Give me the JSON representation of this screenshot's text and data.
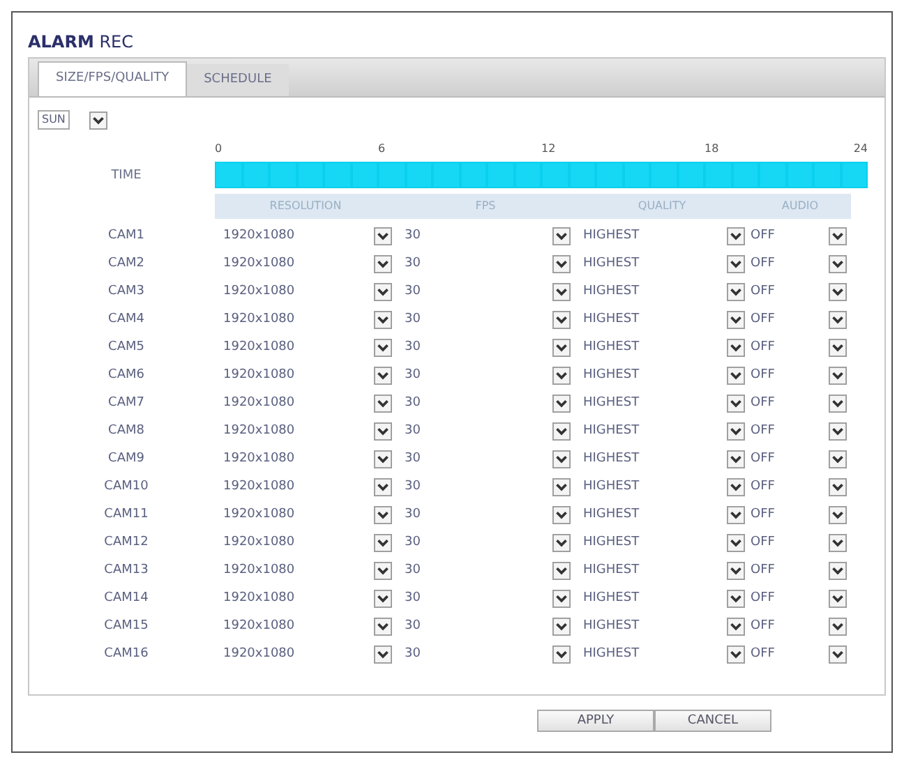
{
  "window": {
    "title_bold": "ALARM",
    "title_rest": "REC"
  },
  "tabs": [
    {
      "label": "SIZE/FPS/QUALITY",
      "selected": true
    },
    {
      "label": "SCHEDULE",
      "selected": false
    }
  ],
  "day_select": {
    "value": "SUN"
  },
  "time_axis": {
    "label": "TIME",
    "ticks": [
      "0",
      "6",
      "12",
      "18",
      "24"
    ]
  },
  "hours": [
    {
      "on": true
    },
    {
      "on": true
    },
    {
      "on": true
    },
    {
      "on": true
    },
    {
      "on": true
    },
    {
      "on": true
    },
    {
      "on": true
    },
    {
      "on": true
    },
    {
      "on": true
    },
    {
      "on": true
    },
    {
      "on": true
    },
    {
      "on": true
    },
    {
      "on": true
    },
    {
      "on": true
    },
    {
      "on": true
    },
    {
      "on": true
    },
    {
      "on": true
    },
    {
      "on": true
    },
    {
      "on": true
    },
    {
      "on": true
    },
    {
      "on": true
    },
    {
      "on": true
    },
    {
      "on": true
    },
    {
      "on": true
    }
  ],
  "table": {
    "columns": [
      "RESOLUTION",
      "FPS",
      "QUALITY",
      "AUDIO"
    ],
    "rows": [
      {
        "camera": "CAM1",
        "resolution": "1920x1080",
        "fps": "30",
        "quality": "HIGHEST",
        "audio": "OFF"
      },
      {
        "camera": "CAM2",
        "resolution": "1920x1080",
        "fps": "30",
        "quality": "HIGHEST",
        "audio": "OFF"
      },
      {
        "camera": "CAM3",
        "resolution": "1920x1080",
        "fps": "30",
        "quality": "HIGHEST",
        "audio": "OFF"
      },
      {
        "camera": "CAM4",
        "resolution": "1920x1080",
        "fps": "30",
        "quality": "HIGHEST",
        "audio": "OFF"
      },
      {
        "camera": "CAM5",
        "resolution": "1920x1080",
        "fps": "30",
        "quality": "HIGHEST",
        "audio": "OFF"
      },
      {
        "camera": "CAM6",
        "resolution": "1920x1080",
        "fps": "30",
        "quality": "HIGHEST",
        "audio": "OFF"
      },
      {
        "camera": "CAM7",
        "resolution": "1920x1080",
        "fps": "30",
        "quality": "HIGHEST",
        "audio": "OFF"
      },
      {
        "camera": "CAM8",
        "resolution": "1920x1080",
        "fps": "30",
        "quality": "HIGHEST",
        "audio": "OFF"
      },
      {
        "camera": "CAM9",
        "resolution": "1920x1080",
        "fps": "30",
        "quality": "HIGHEST",
        "audio": "OFF"
      },
      {
        "camera": "CAM10",
        "resolution": "1920x1080",
        "fps": "30",
        "quality": "HIGHEST",
        "audio": "OFF"
      },
      {
        "camera": "CAM11",
        "resolution": "1920x1080",
        "fps": "30",
        "quality": "HIGHEST",
        "audio": "OFF"
      },
      {
        "camera": "CAM12",
        "resolution": "1920x1080",
        "fps": "30",
        "quality": "HIGHEST",
        "audio": "OFF"
      },
      {
        "camera": "CAM13",
        "resolution": "1920x1080",
        "fps": "30",
        "quality": "HIGHEST",
        "audio": "OFF"
      },
      {
        "camera": "CAM14",
        "resolution": "1920x1080",
        "fps": "30",
        "quality": "HIGHEST",
        "audio": "OFF"
      },
      {
        "camera": "CAM15",
        "resolution": "1920x1080",
        "fps": "30",
        "quality": "HIGHEST",
        "audio": "OFF"
      },
      {
        "camera": "CAM16",
        "resolution": "1920x1080",
        "fps": "30",
        "quality": "HIGHEST",
        "audio": "OFF"
      }
    ]
  },
  "buttons": [
    {
      "label": "APPLY"
    },
    {
      "label": "CANCEL"
    }
  ]
}
